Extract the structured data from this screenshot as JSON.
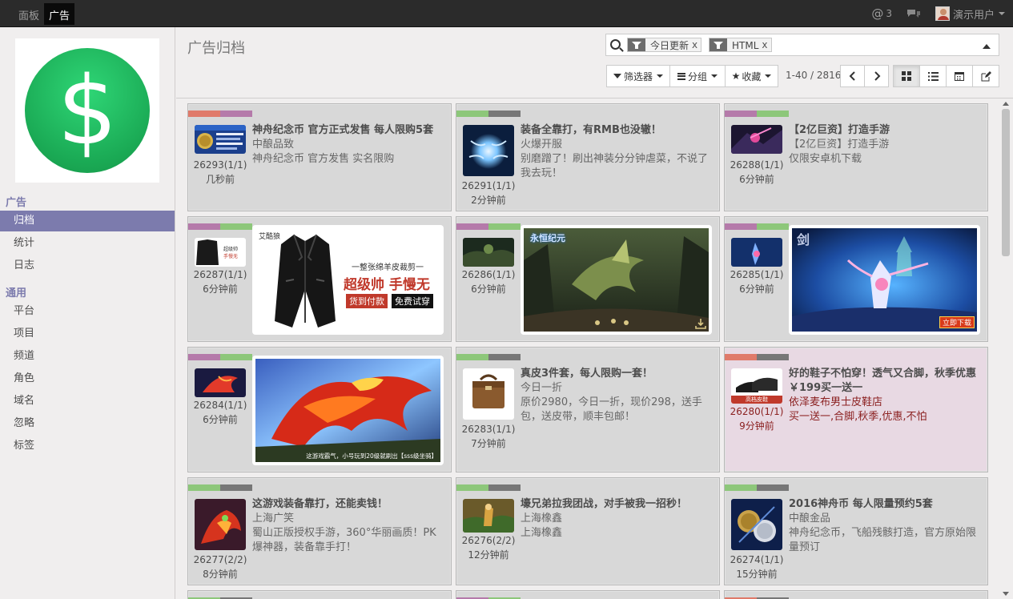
{
  "topbar": {
    "menu": [
      "面板",
      "广告"
    ],
    "mentions_count": "3",
    "user_name": "演示用户"
  },
  "sidebar": {
    "sections": [
      {
        "label": "广告",
        "items": [
          "归档",
          "统计",
          "日志"
        ]
      },
      {
        "label": "通用",
        "items": [
          "平台",
          "项目",
          "频道",
          "角色",
          "域名",
          "忽略",
          "标签"
        ]
      }
    ],
    "active_item": "归档"
  },
  "control": {
    "page_title": "广告归档",
    "facets": [
      "今日更新",
      "HTML"
    ],
    "facet_remove": "x",
    "buttons": {
      "filters": "筛选器",
      "group": "分组",
      "favorites": "收藏"
    },
    "pager": "1-40 / 2816"
  },
  "cards": [
    {
      "tags": [
        "#e07a6a",
        "#b57aaa"
      ],
      "id": "26293(1/1)",
      "time": "几秒前",
      "title": "神舟纪念币 官方正式发售 每人限购5套",
      "sub1": "中酿品致",
      "sub2": "神舟纪念币 官方发售 实名限购"
    },
    {
      "tags": [
        "#8dc77a",
        "#777777"
      ],
      "id": "26291(1/1)",
      "time": "2分钟前",
      "title": "装备全靠打，有RMB也没辙！",
      "sub1": "火爆开服",
      "sub2": "别磨蹭了！刷出神装分分钟虐菜，不说了我去玩！"
    },
    {
      "tags": [
        "#b57aaa",
        "#8dc77a"
      ],
      "id": "26288(1/1)",
      "time": "6分钟前",
      "title": "【2亿巨资】打造手游",
      "sub1": "【2亿巨资】打造手游",
      "sub2": "仅限安卓机下载"
    },
    {
      "tags": [
        "#b57aaa",
        "#8dc77a"
      ],
      "id": "26287(1/1)",
      "time": "6分钟前",
      "banner": {
        "brand": "艾酷狼",
        "line1": "一整张绵羊皮裁剪一",
        "big": "超级帅 手慢无",
        "cta1": "货到付款",
        "cta2": "免费试穿"
      }
    },
    {
      "tags": [
        "#b57aaa",
        "#8dc77a"
      ],
      "id": "26286(1/1)",
      "time": "6分钟前",
      "banner": {
        "logo": "永恒纪元"
      }
    },
    {
      "tags": [
        "#b57aaa",
        "#8dc77a"
      ],
      "id": "26285(1/1)",
      "time": "6分钟前",
      "banner": {
        "cta": "立即下载"
      }
    },
    {
      "tags": [
        "#b57aaa",
        "#8dc77a"
      ],
      "id": "26284(1/1)",
      "time": "6分钟前",
      "banner": {
        "caption": "这游戏霸气，小号玩到20级就刷出【sss级坐骑】"
      }
    },
    {
      "tags": [
        "#8dc77a",
        "#777777"
      ],
      "id": "26283(1/1)",
      "time": "7分钟前",
      "title": "真皮3件套，每人限购一套！",
      "sub1": "今日一折",
      "sub2": "原价2980，今日一折，现价298，送手包，送皮带，顺丰包邮！"
    },
    {
      "tags": [
        "#e07a6a",
        "#777777"
      ],
      "id": "26280(1/1)",
      "time": "9分钟前",
      "title": "好的鞋子不怕穿！透气又合脚，秋季优惠￥199买一送一",
      "sub1": "依泽麦布男士皮鞋店",
      "sub2": "买一送一,合脚,秋季,优惠,不怕",
      "thumb_label": "高档皮鞋"
    },
    {
      "tags": [
        "#8dc77a",
        "#777777"
      ],
      "id": "26277(2/2)",
      "time": "8分钟前",
      "title": "这游戏装备靠打，还能卖钱！",
      "sub1": "上海广笑",
      "sub2": "蜀山正版授权手游，360°华丽画质！PK爆神器，装备靠手打！"
    },
    {
      "tags": [
        "#8dc77a",
        "#777777"
      ],
      "id": "26276(2/2)",
      "time": "12分钟前",
      "title": "壕兄弟拉我团战，对手被我一招秒！",
      "sub1": "上海橡鑫",
      "sub2": "上海橡鑫"
    },
    {
      "tags": [
        "#8dc77a",
        "#777777"
      ],
      "id": "26274(1/1)",
      "time": "15分钟前",
      "title": "2016神舟币 每人限量预约5套",
      "sub1": "中酿金品",
      "sub2": "神舟纪念币，飞船残骸打造，官方原始限量预订"
    }
  ]
}
